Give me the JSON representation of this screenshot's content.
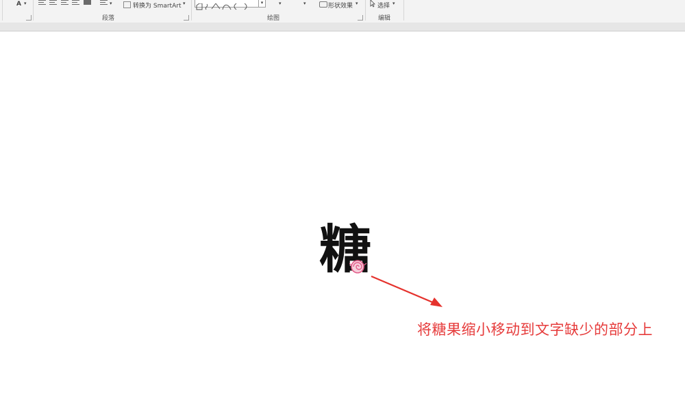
{
  "ribbon": {
    "font_group": {
      "font_color_letter": "A"
    },
    "paragraph_group": {
      "label": "段落",
      "convert_smartart": "转换为 SmartArt"
    },
    "drawing_group": {
      "label": "绘图",
      "shape_effects": "形状效果"
    },
    "editing_group": {
      "label": "编辑",
      "select": "选择"
    }
  },
  "slide": {
    "glyph": "糖",
    "instruction": "将糖果缩小移动到文字缺少的部分上"
  },
  "colors": {
    "instruction_red": "#e63b3b",
    "arrow_red": "#e5322d",
    "candy_pink": "#e35d8a"
  }
}
